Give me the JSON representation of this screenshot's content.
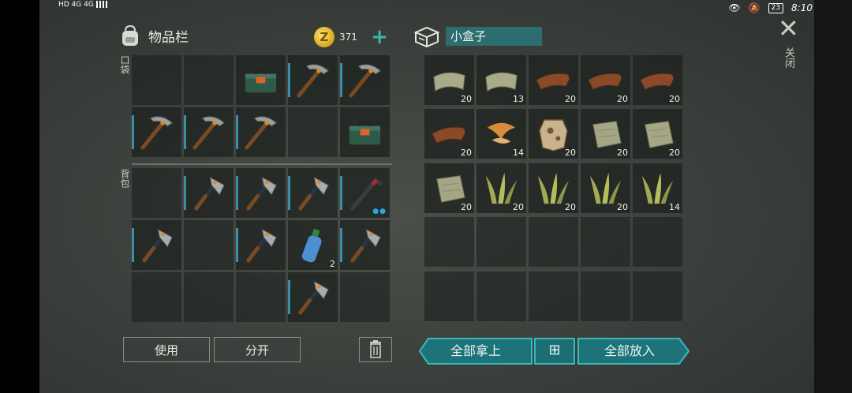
{
  "status_bar": {
    "left": "HD 4G 4G",
    "right_time": "8:10",
    "battery": "23"
  },
  "inventory": {
    "title": "物品栏",
    "coins": "371",
    "add_icon": "plus-icon",
    "pocket_label": "口袋",
    "backpack_label": "背包",
    "pocket_slots": [
      {
        "item": "empty"
      },
      {
        "item": "empty"
      },
      {
        "item": "toolbox",
        "qty": ""
      },
      {
        "item": "pickaxe",
        "qty": ""
      },
      {
        "item": "pickaxe",
        "qty": ""
      },
      {
        "item": "pickaxe",
        "qty": ""
      },
      {
        "item": "pickaxe",
        "qty": ""
      },
      {
        "item": "pickaxe",
        "qty": ""
      },
      {
        "item": "empty"
      },
      {
        "item": "toolbox",
        "qty": ""
      }
    ],
    "backpack_slots": [
      {
        "item": "empty"
      },
      {
        "item": "hatchet",
        "qty": ""
      },
      {
        "item": "hatchet",
        "qty": ""
      },
      {
        "item": "hatchet",
        "qty": ""
      },
      {
        "item": "crowbar",
        "qty": ""
      },
      {
        "item": "hatchet",
        "qty": ""
      },
      {
        "item": "empty"
      },
      {
        "item": "hatchet",
        "qty": ""
      },
      {
        "item": "water-bottle",
        "qty": "2"
      },
      {
        "item": "hatchet",
        "qty": ""
      },
      {
        "item": "empty"
      },
      {
        "item": "empty"
      },
      {
        "item": "empty"
      },
      {
        "item": "hatchet",
        "qty": ""
      },
      {
        "item": "empty"
      }
    ],
    "use_label": "使用",
    "split_label": "分开"
  },
  "container": {
    "name": "小盒子",
    "slots": [
      {
        "item": "cloth",
        "qty": "20"
      },
      {
        "item": "cloth",
        "qty": "13"
      },
      {
        "item": "leather",
        "qty": "20"
      },
      {
        "item": "leather",
        "qty": "20"
      },
      {
        "item": "leather",
        "qty": "20"
      },
      {
        "item": "leather",
        "qty": "20"
      },
      {
        "item": "mushroom",
        "qty": "14"
      },
      {
        "item": "hide",
        "qty": "20"
      },
      {
        "item": "cloth-sack",
        "qty": "20"
      },
      {
        "item": "cloth-sack",
        "qty": "20"
      },
      {
        "item": "cloth-sack",
        "qty": "20"
      },
      {
        "item": "plant-fiber",
        "qty": "20"
      },
      {
        "item": "plant-fiber",
        "qty": "20"
      },
      {
        "item": "plant-fiber",
        "qty": "20"
      },
      {
        "item": "plant-fiber",
        "qty": "14"
      },
      {
        "item": "empty"
      },
      {
        "item": "empty"
      },
      {
        "item": "empty"
      },
      {
        "item": "empty"
      },
      {
        "item": "empty"
      },
      {
        "item": "empty"
      },
      {
        "item": "empty"
      },
      {
        "item": "empty"
      },
      {
        "item": "empty"
      },
      {
        "item": "empty"
      }
    ],
    "take_all_label": "全部拿上",
    "sort_icon": "grid-sort-icon",
    "put_all_label": "全部放入"
  },
  "close_label": "关闭"
}
